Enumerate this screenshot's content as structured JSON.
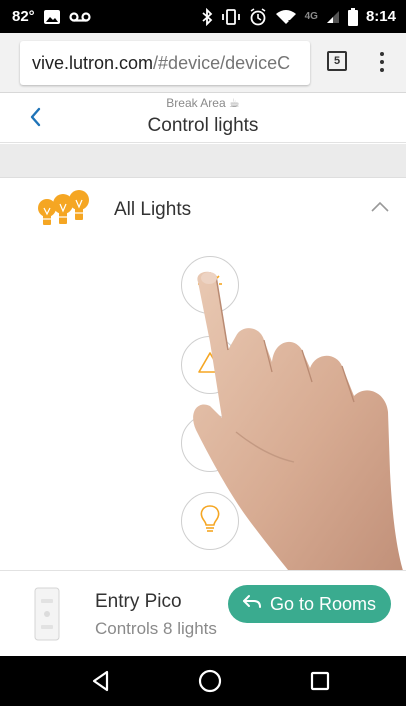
{
  "status_bar": {
    "temperature": "82°",
    "network_label": "4G",
    "time": "8:14",
    "left_icons": [
      "image-icon",
      "voicemail-icon"
    ],
    "right_icons": [
      "bluetooth-icon",
      "vibrate-icon",
      "alarm-icon",
      "wifi-icon",
      "signal-icon",
      "battery-icon"
    ]
  },
  "browser": {
    "url_host": "vive.lutron.com",
    "url_path": "/#device/deviceC",
    "tab_count": "5",
    "menu_icon": "more-vert-icon"
  },
  "header": {
    "breadcrumb": "Break Area ☕",
    "title": "Control lights",
    "back_icon": "chevron-left-icon"
  },
  "group": {
    "label": "All Lights",
    "icon": "light-bulbs-icon",
    "collapse_icon": "chevron-up-icon"
  },
  "controls": [
    {
      "name": "full-on",
      "icon": "sun-bulb-icon"
    },
    {
      "name": "raise",
      "icon": "triangle-up-icon"
    },
    {
      "name": "lower",
      "icon": "triangle-down-icon"
    },
    {
      "name": "off",
      "icon": "bulb-outline-icon"
    }
  ],
  "device": {
    "name": "Entry Pico",
    "subtitle": "Controls 8 lights",
    "thumbnail": "pico-remote-icon"
  },
  "actions": {
    "go_to_rooms": "Go to Rooms",
    "go_to_rooms_icon": "return-arrow-icon"
  },
  "nav_bar": {
    "icons": [
      "back-triangle-icon",
      "home-circle-icon",
      "recents-square-icon"
    ]
  },
  "colors": {
    "accent_orange": "#f5a623",
    "accent_green": "#3aab8f",
    "header_blue": "#1f74b8"
  }
}
